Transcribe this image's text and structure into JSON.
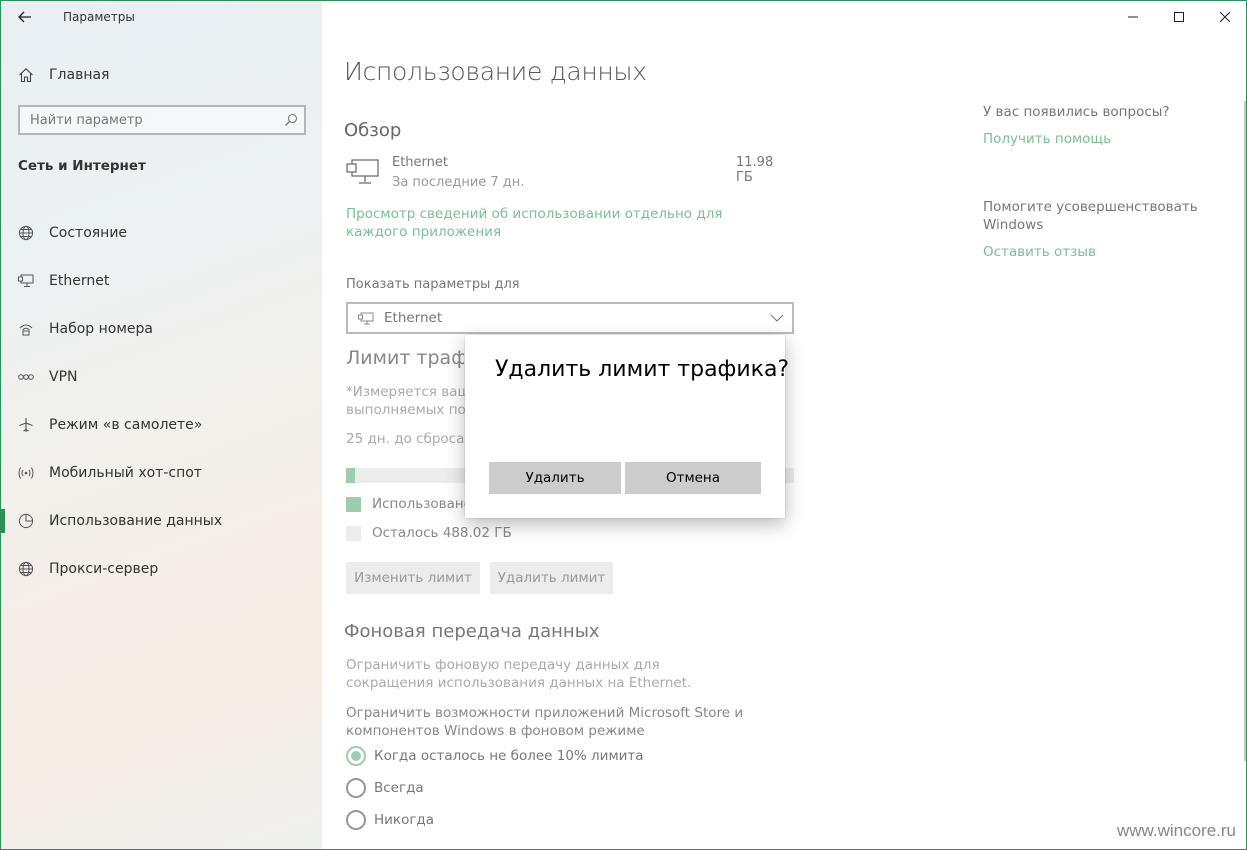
{
  "window": {
    "app_title": "Параметры"
  },
  "sidebar": {
    "home_label": "Главная",
    "search_placeholder": "Найти параметр",
    "section_title": "Сеть и Интернет",
    "items": [
      {
        "label": "Состояние",
        "icon": "globe-icon"
      },
      {
        "label": "Ethernet",
        "icon": "ethernet-icon"
      },
      {
        "label": "Набор номера",
        "icon": "dialup-icon"
      },
      {
        "label": "VPN",
        "icon": "vpn-icon"
      },
      {
        "label": "Режим «в самолете»",
        "icon": "airplane-icon"
      },
      {
        "label": "Мобильный хот-спот",
        "icon": "hotspot-icon"
      },
      {
        "label": "Использование данных",
        "icon": "data-usage-icon",
        "active": true
      },
      {
        "label": "Прокси-сервер",
        "icon": "globe-icon"
      }
    ]
  },
  "main": {
    "page_title": "Использование данных",
    "overview_title": "Обзор",
    "ethernet": {
      "name": "Ethernet",
      "period": "За последние 7 дн.",
      "usage": "11.98 ГБ"
    },
    "usage_link": "Просмотр сведений об использовании отдельно для каждого приложения",
    "show_settings_label": "Показать параметры для",
    "dropdown_value": "Ethernet",
    "limit_title": "Лимит трафика",
    "limit_desc_1": "*Измеряется ваши",
    "limit_desc_2": "выполняемых пост",
    "reset_text": "25 дн. до сброса (1",
    "progress_percent": 2,
    "legend_used": "Использовано",
    "legend_remaining": "Осталось 488.02 ГБ",
    "change_limit_button": "Изменить лимит",
    "remove_limit_button": "Удалить лимит",
    "background_title": "Фоновая передача данных",
    "background_desc": "Ограничить фоновую передачу данных для сокращения использования данных на Ethernet.",
    "background_desc2": "Ограничить возможности приложений Microsoft Store и компонентов Windows в фоновом режиме",
    "radio_options": [
      {
        "label": "Когда осталось не более 10% лимита",
        "checked": true
      },
      {
        "label": "Всегда",
        "checked": false
      },
      {
        "label": "Никогда",
        "checked": false
      }
    ]
  },
  "aside": {
    "question": "У вас появились вопросы?",
    "help_link": "Получить помощь",
    "improve_text": "Помогите усовершенствовать Windows",
    "feedback_link": "Оставить отзыв"
  },
  "dialog": {
    "title": "Удалить лимит трафика?",
    "confirm_button": "Удалить",
    "cancel_button": "Отмена"
  },
  "watermark": "www.wincore.ru",
  "colors": {
    "accent": "#2f8f5a",
    "link": "#7bbf94",
    "progress_fill": "#9ccdae"
  }
}
